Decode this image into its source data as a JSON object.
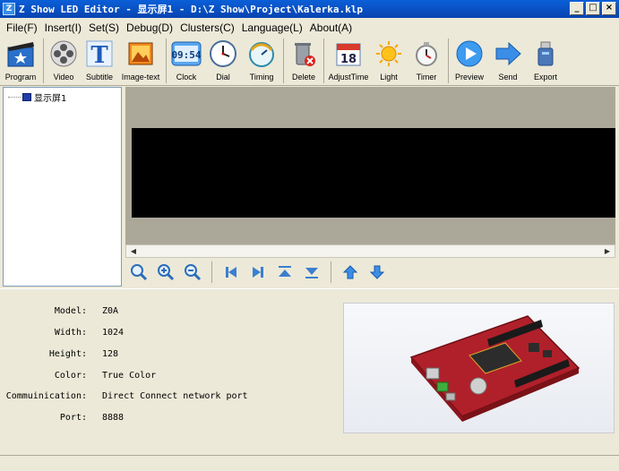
{
  "window": {
    "app_icon": "Z",
    "title": "Z Show LED Editor - 显示屏1 - D:\\Z Show\\Project\\Kalerka.klp",
    "minimize_label": "_",
    "maximize_label": "□",
    "close_label": "×"
  },
  "menu": {
    "file": "File(F)",
    "insert": "Insert(I)",
    "set": "Set(S)",
    "debug": "Debug(D)",
    "clusters": "Clusters(C)",
    "language": "Language(L)",
    "about": "About(A)"
  },
  "toolbar": {
    "program": "Program",
    "video": "Video",
    "subtitle": "Subtitle",
    "image_text": "Image-text",
    "clock": "Clock",
    "clock_display": "09:54",
    "dial": "Dial",
    "timing": "Timing",
    "delete": "Delete",
    "adjust_time": "AdjustTime",
    "adjust_day": "18",
    "light": "Light",
    "timer": "Timer",
    "preview": "Preview",
    "send": "Send",
    "export": "Export"
  },
  "tree": {
    "root_label": "显示屏1"
  },
  "info": {
    "model_label": "Model:",
    "model": "Z0A",
    "width_label": "Width:",
    "width": "1024",
    "height_label": "Height:",
    "height": "128",
    "color_label": "Color:",
    "color": "True Color",
    "comm_label": "Commuinication:",
    "comm": "Direct Connect network port",
    "port_label": "Port:",
    "port": "8888"
  },
  "colors": {
    "titlebar": "#0a5fd8",
    "chrome": "#ece9d8",
    "led_background": "#000000",
    "preview_background": "#aca899",
    "board_red": "#b0202a"
  },
  "icons": [
    "program-icon",
    "video-icon",
    "subtitle-icon",
    "image-text-icon",
    "clock-icon",
    "dial-icon",
    "timing-icon",
    "delete-icon",
    "adjust-time-icon",
    "light-icon",
    "timer-icon",
    "preview-icon",
    "send-icon",
    "export-icon"
  ]
}
